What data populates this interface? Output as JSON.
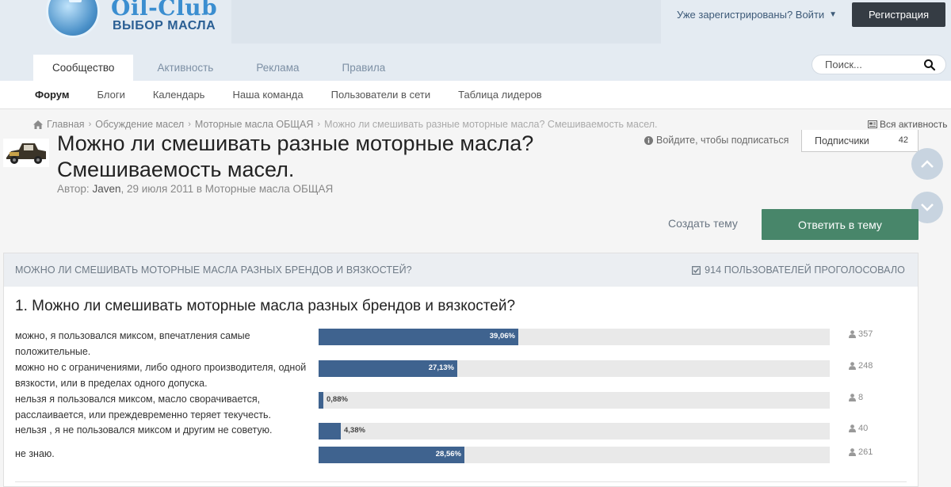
{
  "header": {
    "logo_line1": "Oil-Club",
    "logo_line2": "ВЫБОР МАСЛА",
    "signin_label": "Уже зарегистрированы? Войти",
    "register_label": "Регистрация",
    "tabs": [
      {
        "label": "Сообщество",
        "active": true
      },
      {
        "label": "Активность",
        "active": false
      },
      {
        "label": "Реклама",
        "active": false
      },
      {
        "label": "Правила",
        "active": false
      }
    ],
    "search_placeholder": "Поиск..."
  },
  "subnav": {
    "items": [
      {
        "label": "Форум",
        "active": true
      },
      {
        "label": "Блоги",
        "active": false
      },
      {
        "label": "Календарь",
        "active": false
      },
      {
        "label": "Наша команда",
        "active": false
      },
      {
        "label": "Пользователи в сети",
        "active": false
      },
      {
        "label": "Таблица лидеров",
        "active": false
      }
    ]
  },
  "breadcrumb": {
    "items": [
      "Главная",
      "Обсуждение масел",
      "Моторные масла ОБЩАЯ",
      "Можно ли смешивать разные моторные масла? Смешиваемость масел."
    ],
    "all_activity": "Вся активность"
  },
  "topic": {
    "title": "Можно ли смешивать разные моторные масла? Смешиваемость масел.",
    "author_prefix": "Автор: ",
    "author": "Javen",
    "date": "29 июля 2011",
    "in_word": " в ",
    "forum": "Моторные масла ОБЩАЯ",
    "follow_text": "Войдите, чтобы подписаться",
    "followers_label": "Подписчики",
    "followers_count": "42",
    "create_topic": "Создать тему",
    "reply": "Ответить в тему"
  },
  "poll": {
    "header_title": "МОЖНО ЛИ СМЕШИВАТЬ МОТОРНЫЕ МАСЛА РАЗНЫХ БРЕНДОВ И ВЯЗКОСТЕЙ?",
    "total_votes": "914 ПОЛЬЗОВАТЕЛЕЙ ПРОГОЛОСОВАЛО",
    "question": "1. Можно ли смешивать моторные масла разных брендов и вязкостей?",
    "options": [
      {
        "label": "можно, я пользовался миксом, впечатления самые положительные.",
        "percent": 39.06,
        "percent_label": "39,06%",
        "votes": "357"
      },
      {
        "label": "можно но с ограничениями, либо одного производителя, одной вязкости, или в пределах одного допуска.",
        "percent": 27.13,
        "percent_label": "27,13%",
        "votes": "248"
      },
      {
        "label": "нельзя я пользовался миксом, масло сворачивается, расслаивается, или преждевременно теряет текучесть.",
        "percent": 0.88,
        "percent_label": "0,88%",
        "votes": "8"
      },
      {
        "label": "нельзя , я не пользовался миксом и другим не советую.",
        "percent": 4.38,
        "percent_label": "4,38%",
        "votes": "40"
      },
      {
        "label": "не знаю.",
        "percent": 28.56,
        "percent_label": "28,56%",
        "votes": "261"
      }
    ]
  },
  "colors": {
    "bar_fill": "#3f638f",
    "reply_button": "#48866a",
    "register_button": "#353c44"
  }
}
